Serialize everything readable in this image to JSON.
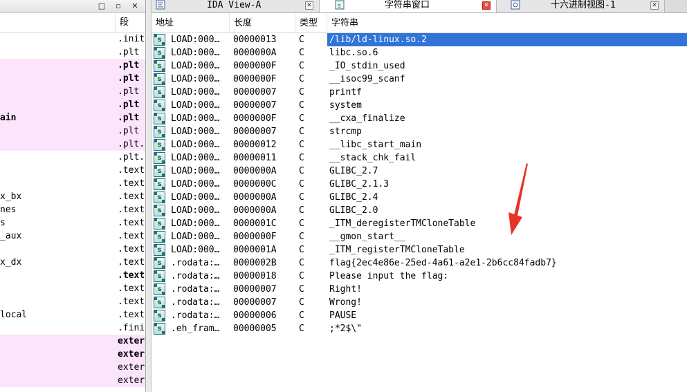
{
  "left_pane": {
    "segment_header": "段",
    "window_buttons": [
      "□",
      "▫",
      "✕"
    ],
    "rows": [
      {
        "name": "",
        "segment": ".init",
        "pink": false,
        "bold": false
      },
      {
        "name": "",
        "segment": ".plt",
        "pink": false,
        "bold": false
      },
      {
        "name": "",
        "segment": ".plt",
        "pink": true,
        "bold": true
      },
      {
        "name": "",
        "segment": ".plt",
        "pink": true,
        "bold": true
      },
      {
        "name": "",
        "segment": ".plt",
        "pink": true,
        "bold": false
      },
      {
        "name": "",
        "segment": ".plt",
        "pink": true,
        "bold": true
      },
      {
        "name": "ain",
        "segment": ".plt",
        "pink": true,
        "bold": true
      },
      {
        "name": "",
        "segment": ".plt",
        "pink": true,
        "bold": false
      },
      {
        "name": "",
        "segment": ".plt.",
        "pink": true,
        "bold": false
      },
      {
        "name": "",
        "segment": ".plt.",
        "pink": false,
        "bold": false
      },
      {
        "name": "",
        "segment": ".text",
        "pink": false,
        "bold": false
      },
      {
        "name": "",
        "segment": ".text",
        "pink": false,
        "bold": false
      },
      {
        "name": "x_bx",
        "segment": ".text",
        "pink": false,
        "bold": false
      },
      {
        "name": "nes",
        "segment": ".text",
        "pink": false,
        "bold": false
      },
      {
        "name": "s",
        "segment": ".text",
        "pink": false,
        "bold": false
      },
      {
        "name": "_aux",
        "segment": ".text",
        "pink": false,
        "bold": false
      },
      {
        "name": "",
        "segment": ".text",
        "pink": false,
        "bold": false
      },
      {
        "name": "x_dx",
        "segment": ".text",
        "pink": false,
        "bold": false
      },
      {
        "name": "",
        "segment": ".text",
        "pink": false,
        "bold": true
      },
      {
        "name": "",
        "segment": ".text",
        "pink": false,
        "bold": false
      },
      {
        "name": "",
        "segment": ".text",
        "pink": false,
        "bold": false
      },
      {
        "name": "local",
        "segment": ".text",
        "pink": false,
        "bold": false
      },
      {
        "name": "",
        "segment": ".fini",
        "pink": false,
        "bold": false
      },
      {
        "name": "",
        "segment": "exter",
        "pink": true,
        "bold": true
      },
      {
        "name": "",
        "segment": "exter",
        "pink": true,
        "bold": true
      },
      {
        "name": "",
        "segment": "exter",
        "pink": true,
        "bold": false
      },
      {
        "name": "",
        "segment": "exter",
        "pink": true,
        "bold": false
      }
    ]
  },
  "tabs": [
    {
      "label": "IDA View-A",
      "active": false,
      "icon": "ida-view-icon"
    },
    {
      "label": "字符串窗口",
      "active": true,
      "icon": "strings-window-icon"
    },
    {
      "label": "十六进制视图-1",
      "active": false,
      "icon": "hex-view-icon"
    }
  ],
  "strings_table": {
    "headers": {
      "address": "地址",
      "length": "长度",
      "type": "类型",
      "string": "字符串"
    },
    "rows": [
      {
        "address": "LOAD:000…",
        "length": "00000013",
        "type": "C",
        "string": "/lib/ld-linux.so.2",
        "selected": true
      },
      {
        "address": "LOAD:000…",
        "length": "0000000A",
        "type": "C",
        "string": "libc.so.6"
      },
      {
        "address": "LOAD:000…",
        "length": "0000000F",
        "type": "C",
        "string": "_IO_stdin_used"
      },
      {
        "address": "LOAD:000…",
        "length": "0000000F",
        "type": "C",
        "string": "__isoc99_scanf"
      },
      {
        "address": "LOAD:000…",
        "length": "00000007",
        "type": "C",
        "string": "printf"
      },
      {
        "address": "LOAD:000…",
        "length": "00000007",
        "type": "C",
        "string": "system"
      },
      {
        "address": "LOAD:000…",
        "length": "0000000F",
        "type": "C",
        "string": "__cxa_finalize"
      },
      {
        "address": "LOAD:000…",
        "length": "00000007",
        "type": "C",
        "string": "strcmp"
      },
      {
        "address": "LOAD:000…",
        "length": "00000012",
        "type": "C",
        "string": "__libc_start_main"
      },
      {
        "address": "LOAD:000…",
        "length": "00000011",
        "type": "C",
        "string": "__stack_chk_fail"
      },
      {
        "address": "LOAD:000…",
        "length": "0000000A",
        "type": "C",
        "string": "GLIBC_2.7"
      },
      {
        "address": "LOAD:000…",
        "length": "0000000C",
        "type": "C",
        "string": "GLIBC_2.1.3"
      },
      {
        "address": "LOAD:000…",
        "length": "0000000A",
        "type": "C",
        "string": "GLIBC_2.4"
      },
      {
        "address": "LOAD:000…",
        "length": "0000000A",
        "type": "C",
        "string": "GLIBC_2.0"
      },
      {
        "address": "LOAD:000…",
        "length": "0000001C",
        "type": "C",
        "string": "_ITM_deregisterTMCloneTable"
      },
      {
        "address": "LOAD:000…",
        "length": "0000000F",
        "type": "C",
        "string": "__gmon_start__"
      },
      {
        "address": "LOAD:000…",
        "length": "0000001A",
        "type": "C",
        "string": "_ITM_registerTMCloneTable"
      },
      {
        "address": ".rodata:…",
        "length": "0000002B",
        "type": "C",
        "string": "flag{2ec4e86e-25ed-4a61-a2e1-2b6cc84fadb7}"
      },
      {
        "address": ".rodata:…",
        "length": "00000018",
        "type": "C",
        "string": "Please input the flag:"
      },
      {
        "address": ".rodata:…",
        "length": "00000007",
        "type": "C",
        "string": "Right!"
      },
      {
        "address": ".rodata:…",
        "length": "00000007",
        "type": "C",
        "string": "Wrong!"
      },
      {
        "address": ".rodata:…",
        "length": "00000006",
        "type": "C",
        "string": "PAUSE"
      },
      {
        "address": ".eh_fram…",
        "length": "00000005",
        "type": "C",
        "string": ";*2$\\\""
      }
    ]
  },
  "colors": {
    "selection": "#3074d8",
    "pink_row": "#fce4fc",
    "arrow": "#e8332a",
    "active_tab_close": "#e84a3c"
  }
}
